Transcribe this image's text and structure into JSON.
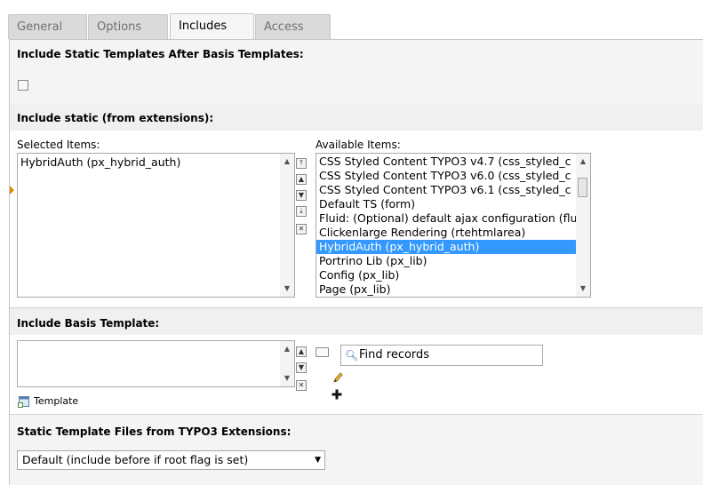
{
  "tabs": [
    {
      "label": "General"
    },
    {
      "label": "Options"
    },
    {
      "label": "Includes"
    },
    {
      "label": "Access"
    }
  ],
  "active_tab": "Includes",
  "section_after_basis": {
    "title": "Include Static Templates After Basis Templates:",
    "checked": false
  },
  "section_static": {
    "title": "Include static (from extensions):",
    "selected_label": "Selected Items:",
    "available_label": "Available Items:",
    "selected_items": [
      "HybridAuth (px_hybrid_auth)"
    ],
    "available_items": [
      "CSS Styled Content TYPO3 v4.7 (css_styled_c",
      "CSS Styled Content TYPO3 v6.0 (css_styled_c",
      "CSS Styled Content TYPO3 v6.1 (css_styled_c",
      "Default TS (form)",
      "Fluid: (Optional) default ajax configuration (flu",
      "Clickenlarge Rendering (rtehtmlarea)",
      "HybridAuth (px_hybrid_auth)",
      "Portrino Lib (px_lib)",
      "Config (px_lib)",
      "Page (px_lib)"
    ],
    "highlighted_available": "HybridAuth (px_hybrid_auth)"
  },
  "section_basis": {
    "title": "Include Basis Template:",
    "find_placeholder": "Find records",
    "template_link": "Template"
  },
  "section_files": {
    "title": "Static Template Files from TYPO3 Extensions:",
    "select_value": "Default (include before if root flag is set)"
  },
  "colors": {
    "selection": "#3399ff",
    "tab_inactive": "#dadada",
    "tab_active": "#f6f6f6",
    "section_header_bg": "#f0f0f0",
    "accent_marker": "#e08a00"
  }
}
